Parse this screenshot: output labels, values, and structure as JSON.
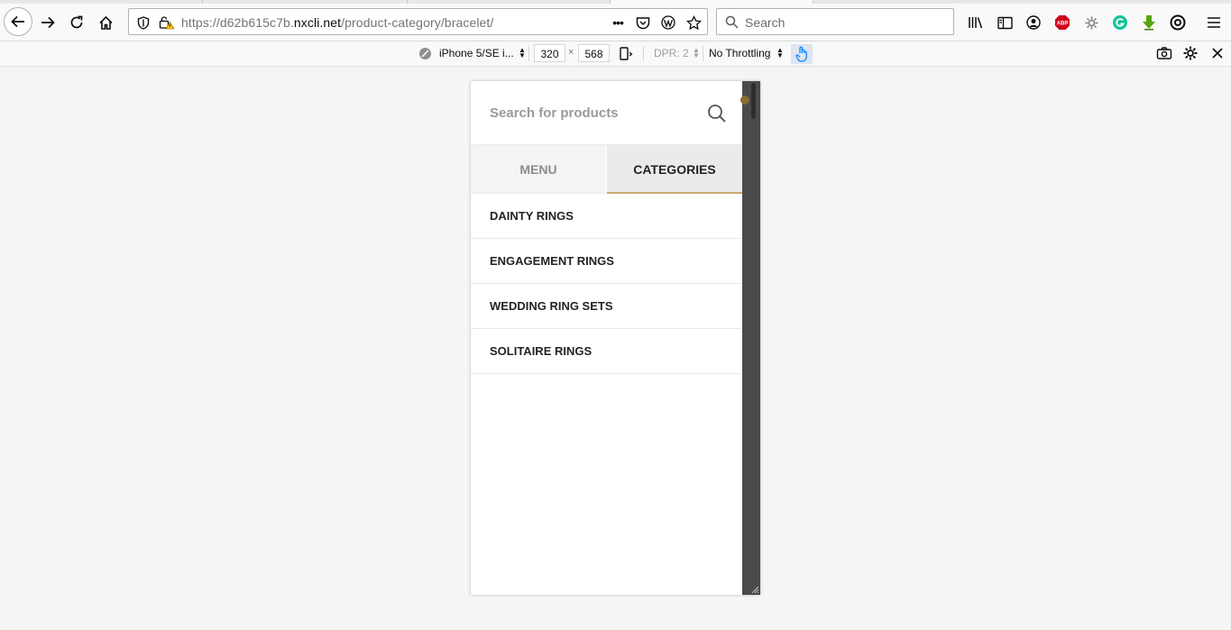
{
  "browser": {
    "url_scheme": "https://",
    "url_host_prefix": "d62b615c7b.",
    "url_host": "nxcli.net",
    "url_path": "/product-category/bracelet/",
    "search_placeholder": "Search",
    "overflow_label": "•••",
    "adblock_label": "ABP"
  },
  "responsive_toolbar": {
    "device": "iPhone 5/SE i...",
    "width": "320",
    "height": "568",
    "times": "×",
    "dpr": "DPR: 2",
    "throttling": "No Throttling"
  },
  "mobile_page": {
    "search_placeholder": "Search for products",
    "tabs": [
      {
        "label": "MENU",
        "active": false
      },
      {
        "label": "CATEGORIES",
        "active": true
      }
    ],
    "categories": [
      "DAINTY RINGS",
      "ENGAGEMENT RINGS",
      "WEDDING RING SETS",
      "SOLITAIRE RINGS"
    ],
    "accent_color": "#c9a96e"
  }
}
